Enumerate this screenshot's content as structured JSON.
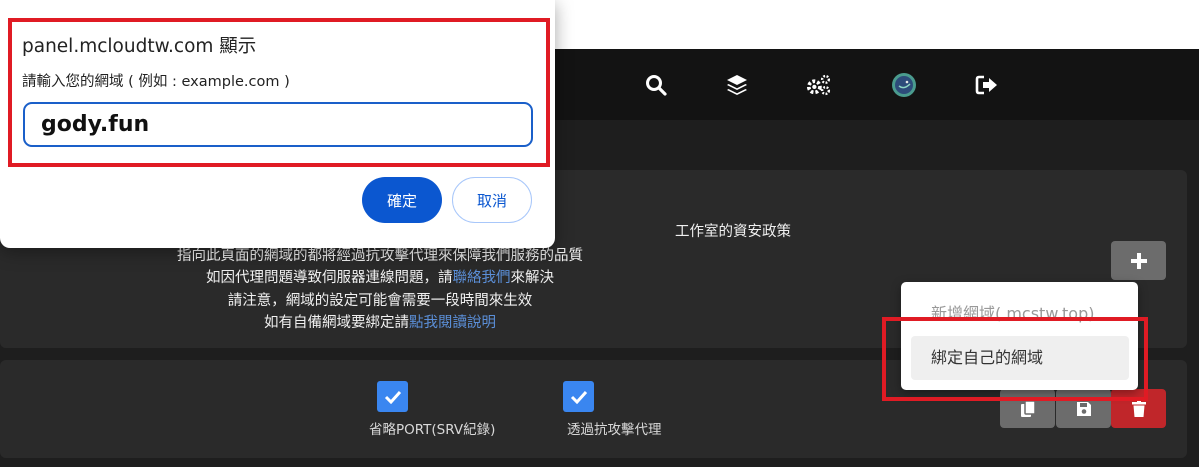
{
  "navbar": {
    "icons": [
      "search-icon",
      "layers-icon",
      "gears-icon",
      "avatar",
      "logout-icon"
    ]
  },
  "info": {
    "line1_suffix": "工作室的資安政策",
    "line2": "指向此頁面的網域的都將經過抗攻擊代理來保障我們服務的品質",
    "line3_prefix": "如因代理問題導致伺服器連線問題，請",
    "line3_link": "聯絡我們",
    "line3_suffix": "來解決",
    "line4": "請注意，網域的設定可能會需要一段時間來生效",
    "line5_prefix": "如有自備網域要綁定請",
    "line5_link": "點我閱讀說明"
  },
  "add_button": {
    "label": "+"
  },
  "dropdown": {
    "items": [
      {
        "label": "新增網域(.mcstw.top)"
      },
      {
        "label": "綁定自己的網域"
      }
    ]
  },
  "domain_row": {
    "options": [
      {
        "label": "省略PORT(SRV紀錄)",
        "checked": true
      },
      {
        "label": "透過抗攻擊代理",
        "checked": true
      }
    ],
    "actions": [
      "copy-icon",
      "save-icon",
      "trash-icon"
    ]
  },
  "dialog": {
    "title": "panel.mcloudtw.com 顯示",
    "message": "請輸入您的網域 ( 例如 : example.com )",
    "input_value": "gody.fun",
    "ok_label": "確定",
    "cancel_label": "取消"
  },
  "colors": {
    "primary_button": "#0b57d0",
    "checkbox": "#3a86f0",
    "delete_button": "#c0262a",
    "highlight": "#e01b24",
    "link": "#5b8fd8"
  }
}
